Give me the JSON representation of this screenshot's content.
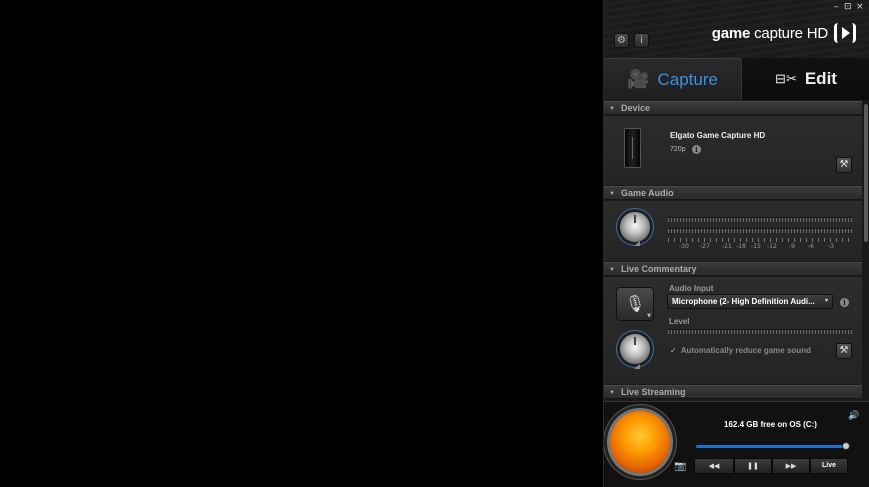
{
  "header": {
    "window_controls": [
      "–",
      "⊡",
      "×"
    ],
    "settings_icon": "gear-icon",
    "info_icon": "info-icon",
    "logo_bold": "game",
    "logo_rest": " capture HD"
  },
  "tabs": {
    "capture": {
      "label": "Capture",
      "icon": "camera-operator-icon",
      "glyph": "🎥"
    },
    "edit": {
      "label": "Edit",
      "icon": "scissors-edit-icon",
      "glyph": "⊟✂"
    }
  },
  "sections": {
    "device": "Device",
    "game_audio": "Game Audio",
    "live_commentary": "Live Commentary",
    "live_streaming": "Live Streaming"
  },
  "device": {
    "name": "Elgato Game Capture HD",
    "resolution": "720p"
  },
  "game_audio": {
    "scale": [
      "-30",
      "-27",
      "-21",
      "-18",
      "-15",
      "-12",
      "-9",
      "-6",
      "-3"
    ]
  },
  "live_commentary": {
    "audio_input_label": "Audio Input",
    "audio_input_value": "Microphone (2- High Definition Audi...",
    "level_label": "Level",
    "auto_reduce_label": "Automatically reduce game sound"
  },
  "bottom": {
    "storage_text": "162.4 GB free on OS (C:)",
    "timeline_fraction": 1.0,
    "buttons": {
      "rewind": "◀◀",
      "pause": "❚❚",
      "forward": "▶▶",
      "live": "Live"
    }
  }
}
